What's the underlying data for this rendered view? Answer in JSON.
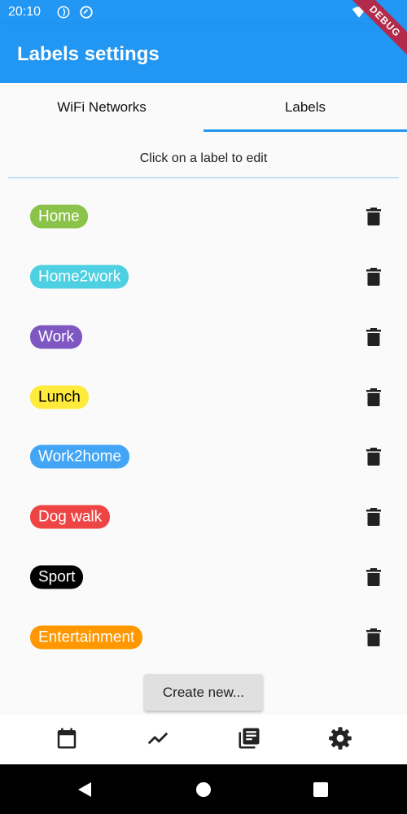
{
  "status_bar": {
    "time": "20:10",
    "icons": [
      "data-saver-icon",
      "vpn-icon"
    ],
    "right_icons": [
      "wifi-icon",
      "signal-icon",
      "battery-icon"
    ]
  },
  "debug_banner": "DEBUG",
  "app_bar": {
    "title": "Labels settings"
  },
  "tabs": [
    {
      "label": "WiFi Networks",
      "selected": false
    },
    {
      "label": "Labels",
      "selected": true
    }
  ],
  "hint": "Click on a label to edit",
  "labels": [
    {
      "name": "Home",
      "color": "#8bc34a",
      "text_color": "#ffffff"
    },
    {
      "name": "Home2work",
      "color": "#4dd0e1",
      "text_color": "#ffffff"
    },
    {
      "name": "Work",
      "color": "#7e57c2",
      "text_color": "#ffffff"
    },
    {
      "name": "Lunch",
      "color": "#ffeb3b",
      "text_color": "#000000"
    },
    {
      "name": "Work2home",
      "color": "#42a5f5",
      "text_color": "#ffffff"
    },
    {
      "name": "Dog walk",
      "color": "#ef4444",
      "text_color": "#ffffff"
    },
    {
      "name": "Sport",
      "color": "#000000",
      "text_color": "#ffffff"
    },
    {
      "name": "Entertainment",
      "color": "#ff9800",
      "text_color": "#ffffff"
    }
  ],
  "create_button": "Create new...",
  "bottom_nav": [
    "calendar-icon",
    "chart-icon",
    "library-icon",
    "settings-icon"
  ],
  "system_nav": [
    "back-icon",
    "home-icon",
    "recents-icon"
  ],
  "colors": {
    "primary": "#2196f3",
    "trash": "#222222"
  }
}
